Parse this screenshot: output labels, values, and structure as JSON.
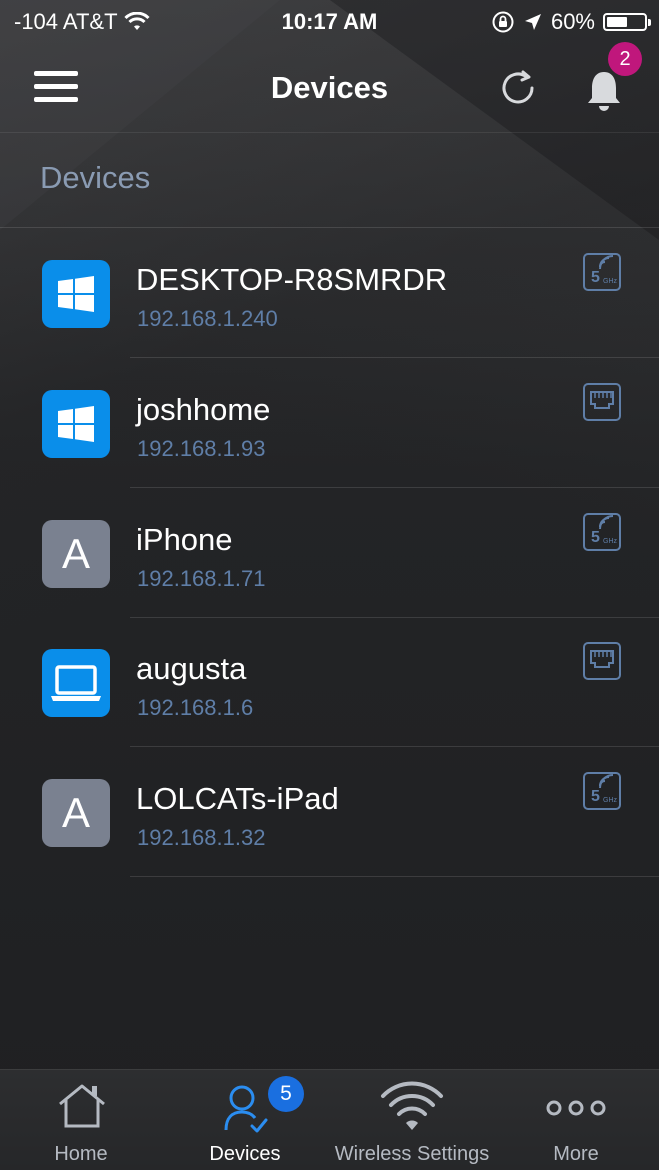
{
  "status_bar": {
    "carrier": "-104 AT&T",
    "time": "10:17 AM",
    "battery": "60%",
    "battery_level": 0.6
  },
  "nav": {
    "title": "Devices",
    "notification_count": "2"
  },
  "section": {
    "header": "Devices"
  },
  "devices": [
    {
      "name": "DESKTOP-R8SMRDR",
      "ip": "192.168.1.240",
      "icon": "windows-icon",
      "connection": "5ghz-wifi-icon"
    },
    {
      "name": "joshhome",
      "ip": "192.168.1.93",
      "icon": "windows-icon",
      "connection": "ethernet-icon"
    },
    {
      "name": "iPhone",
      "ip": "192.168.1.71",
      "icon": "letter-a-icon",
      "connection": "5ghz-wifi-icon"
    },
    {
      "name": "augusta",
      "ip": "192.168.1.6",
      "icon": "laptop-icon",
      "connection": "ethernet-icon"
    },
    {
      "name": "LOLCATs-iPad",
      "ip": "192.168.1.32",
      "icon": "letter-a-icon",
      "connection": "5ghz-wifi-icon"
    }
  ],
  "icon_letters": {
    "generic": "A",
    "wifi_band": "5",
    "wifi_unit": "GHz"
  },
  "tabbar": {
    "tabs": [
      {
        "label": "Home",
        "icon": "home-icon"
      },
      {
        "label": "Devices",
        "icon": "devices-icon",
        "badge": "5",
        "active": true
      },
      {
        "label": "Wireless Settings",
        "icon": "wifi-icon"
      },
      {
        "label": "More",
        "icon": "more-icon"
      }
    ]
  },
  "colors": {
    "accent_blue": "#0a8eea",
    "ip_text": "#5f7ea7",
    "section_header": "#8a9bb3",
    "notification_badge": "#c0177c",
    "tab_badge": "#1a6fe0",
    "generic_tile": "#7a8190"
  }
}
